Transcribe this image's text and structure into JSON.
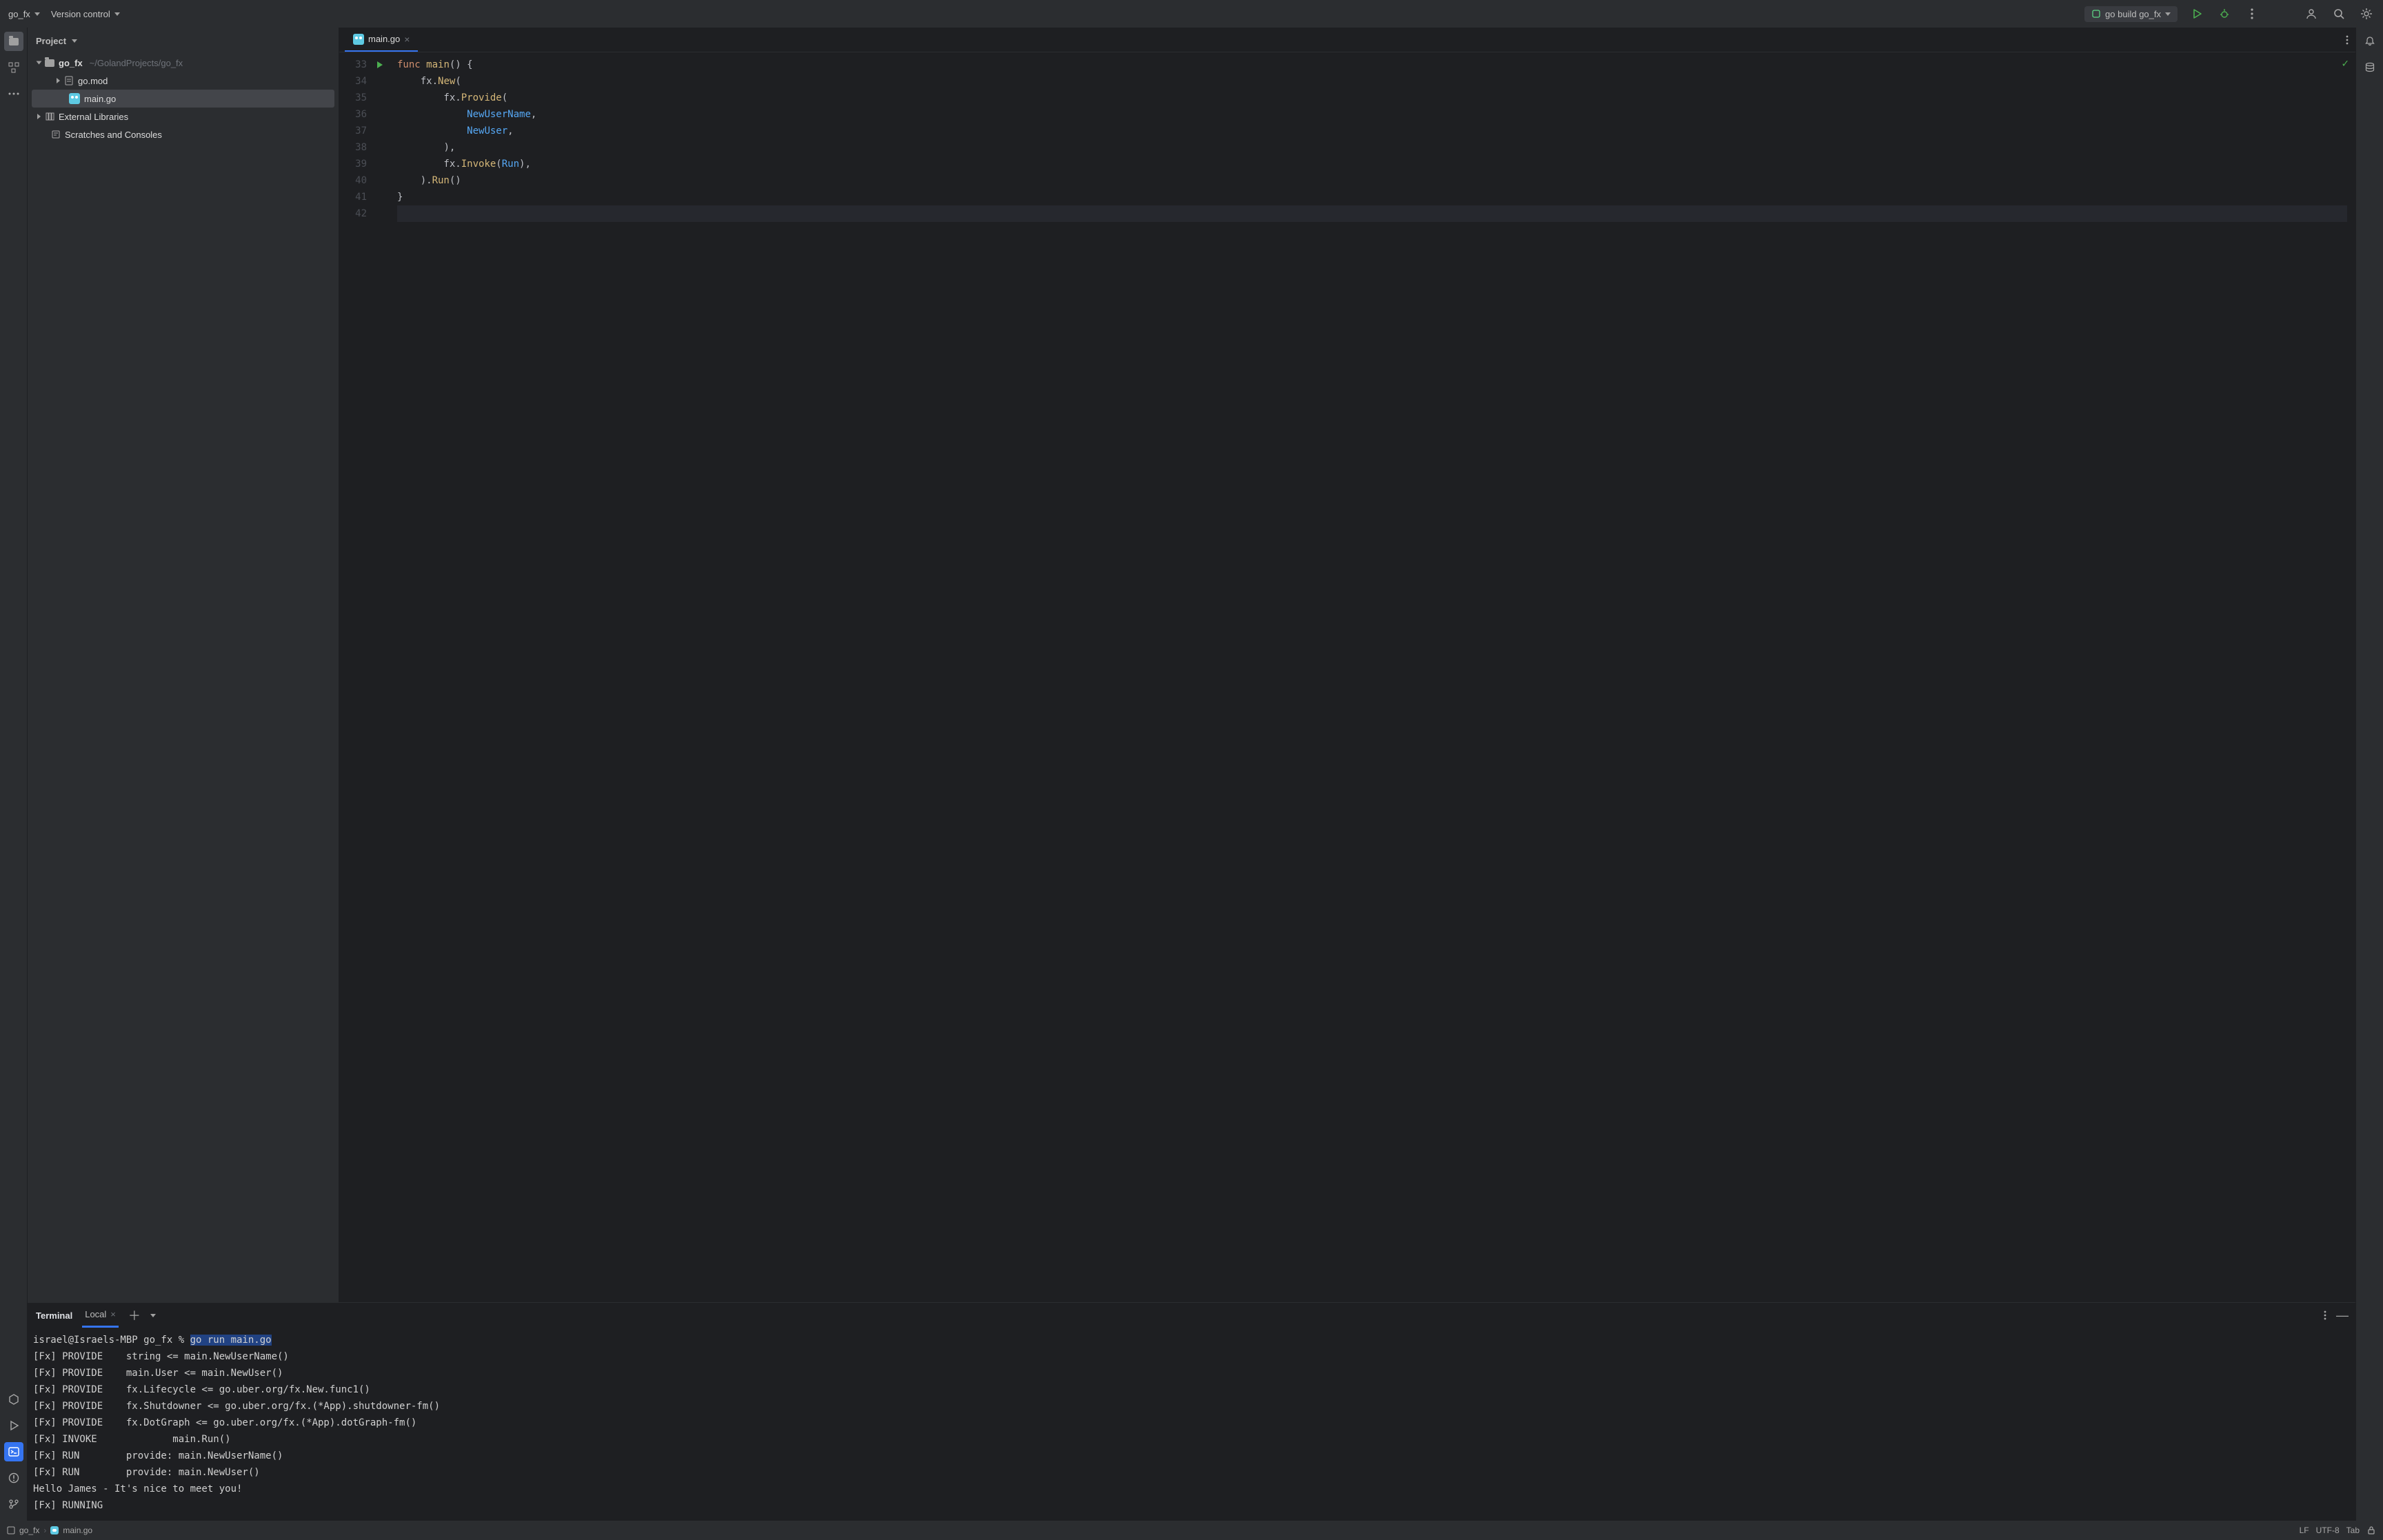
{
  "titlebar": {
    "project_name": "go_fx",
    "vcs_label": "Version control",
    "run_config": "go build go_fx"
  },
  "project_panel": {
    "title": "Project",
    "root": {
      "name": "go_fx",
      "path": "~/GolandProjects/go_fx"
    },
    "files": [
      {
        "name": "go.mod"
      },
      {
        "name": "main.go",
        "selected": true
      }
    ],
    "ext_libs": "External Libraries",
    "scratches": "Scratches and Consoles"
  },
  "editor": {
    "tab_name": "main.go",
    "first_line_no": 33,
    "lines": [
      {
        "n": 33,
        "run": true,
        "tokens": [
          [
            "kw",
            "func "
          ],
          [
            "ident",
            "main"
          ],
          [
            "punc",
            "() {"
          ]
        ]
      },
      {
        "n": 34,
        "tokens": [
          [
            "plain",
            "    fx."
          ],
          [
            "ident",
            "New"
          ],
          [
            "punc",
            "("
          ]
        ]
      },
      {
        "n": 35,
        "tokens": [
          [
            "plain",
            "        fx."
          ],
          [
            "ident",
            "Provide"
          ],
          [
            "punc",
            "("
          ]
        ]
      },
      {
        "n": 36,
        "tokens": [
          [
            "plain",
            "            "
          ],
          [
            "call",
            "NewUserName"
          ],
          [
            "punc",
            ","
          ]
        ]
      },
      {
        "n": 37,
        "tokens": [
          [
            "plain",
            "            "
          ],
          [
            "call",
            "NewUser"
          ],
          [
            "punc",
            ","
          ]
        ]
      },
      {
        "n": 38,
        "tokens": [
          [
            "plain",
            "        "
          ],
          [
            "punc",
            "),"
          ]
        ]
      },
      {
        "n": 39,
        "tokens": [
          [
            "plain",
            "        fx."
          ],
          [
            "ident",
            "Invoke"
          ],
          [
            "punc",
            "("
          ],
          [
            "call",
            "Run"
          ],
          [
            "punc",
            "),"
          ]
        ]
      },
      {
        "n": 40,
        "tokens": [
          [
            "plain",
            "    )."
          ],
          [
            "ident",
            "Run"
          ],
          [
            "punc",
            "()"
          ]
        ]
      },
      {
        "n": 41,
        "tokens": [
          [
            "punc",
            "}"
          ]
        ]
      },
      {
        "n": 42,
        "hl": true,
        "tokens": [
          [
            "plain",
            ""
          ]
        ]
      }
    ]
  },
  "terminal": {
    "title": "Terminal",
    "tab": "Local",
    "prompt": "israel@Israels-MBP go_fx % ",
    "command": "go run main.go",
    "output": [
      "[Fx] PROVIDE    string <= main.NewUserName()",
      "[Fx] PROVIDE    main.User <= main.NewUser()",
      "[Fx] PROVIDE    fx.Lifecycle <= go.uber.org/fx.New.func1()",
      "[Fx] PROVIDE    fx.Shutdowner <= go.uber.org/fx.(*App).shutdowner-fm()",
      "[Fx] PROVIDE    fx.DotGraph <= go.uber.org/fx.(*App).dotGraph-fm()",
      "[Fx] INVOKE             main.Run()",
      "[Fx] RUN        provide: main.NewUserName()",
      "[Fx] RUN        provide: main.NewUser()",
      "Hello James - It's nice to meet you!",
      "[Fx] RUNNING"
    ]
  },
  "statusbar": {
    "crumb_project": "go_fx",
    "crumb_file": "main.go",
    "line_ending": "LF",
    "encoding": "UTF-8",
    "indent": "Tab"
  }
}
